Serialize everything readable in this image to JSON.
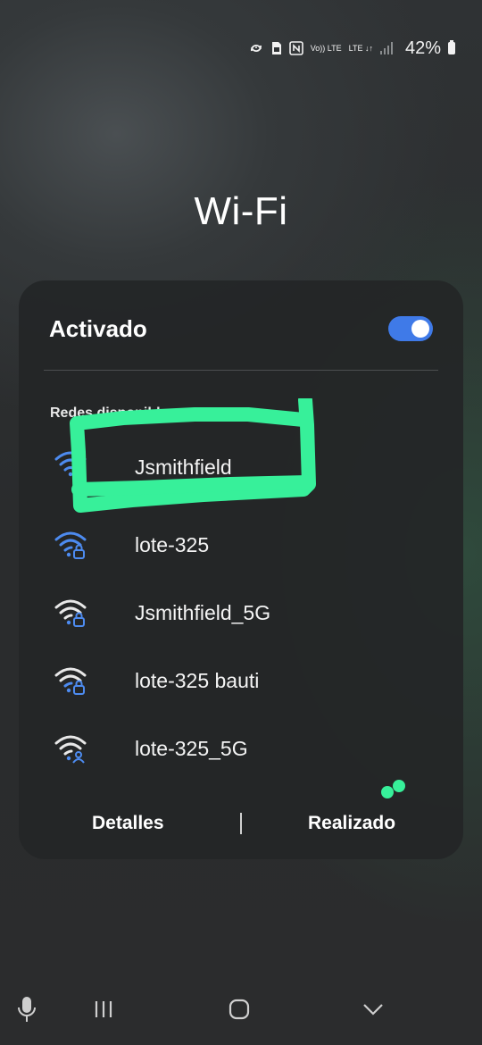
{
  "status": {
    "battery_percent": "42%",
    "icons": [
      "sync-icon",
      "sim-icon",
      "nfc-icon",
      "volte-icon",
      "lte-icon",
      "signal-icon",
      "battery-icon"
    ],
    "volte_label": "Vo)) LTE",
    "lte_label": "LTE ↓↑"
  },
  "title": "Wi-Fi",
  "panel": {
    "toggle_label": "Activado",
    "toggle_on": true,
    "section_label": "Redes disponibles",
    "networks": [
      {
        "name": "Jsmithfield",
        "icon": "wifi-lock-icon",
        "color": "#4d8bf0"
      },
      {
        "name": "lote-325",
        "icon": "wifi-lock-icon",
        "color": "#4d8bf0"
      },
      {
        "name": "Jsmithfield_5G",
        "icon": "wifi-lock-icon",
        "color": "#e8e8e8"
      },
      {
        "name": "lote-325 bauti",
        "icon": "wifi-lock-icon",
        "color": "#e8e8e8"
      },
      {
        "name": "lote-325_5G",
        "icon": "wifi-user-icon",
        "color": "#e8e8e8"
      }
    ],
    "details_button": "Detalles",
    "done_button": "Realizado"
  },
  "nav": {
    "icons": [
      "microphone-icon",
      "recent-apps-icon",
      "home-icon",
      "hide-keyboard-icon"
    ]
  },
  "colors": {
    "accent": "#3f7ae8",
    "highlight": "#37f09a"
  }
}
